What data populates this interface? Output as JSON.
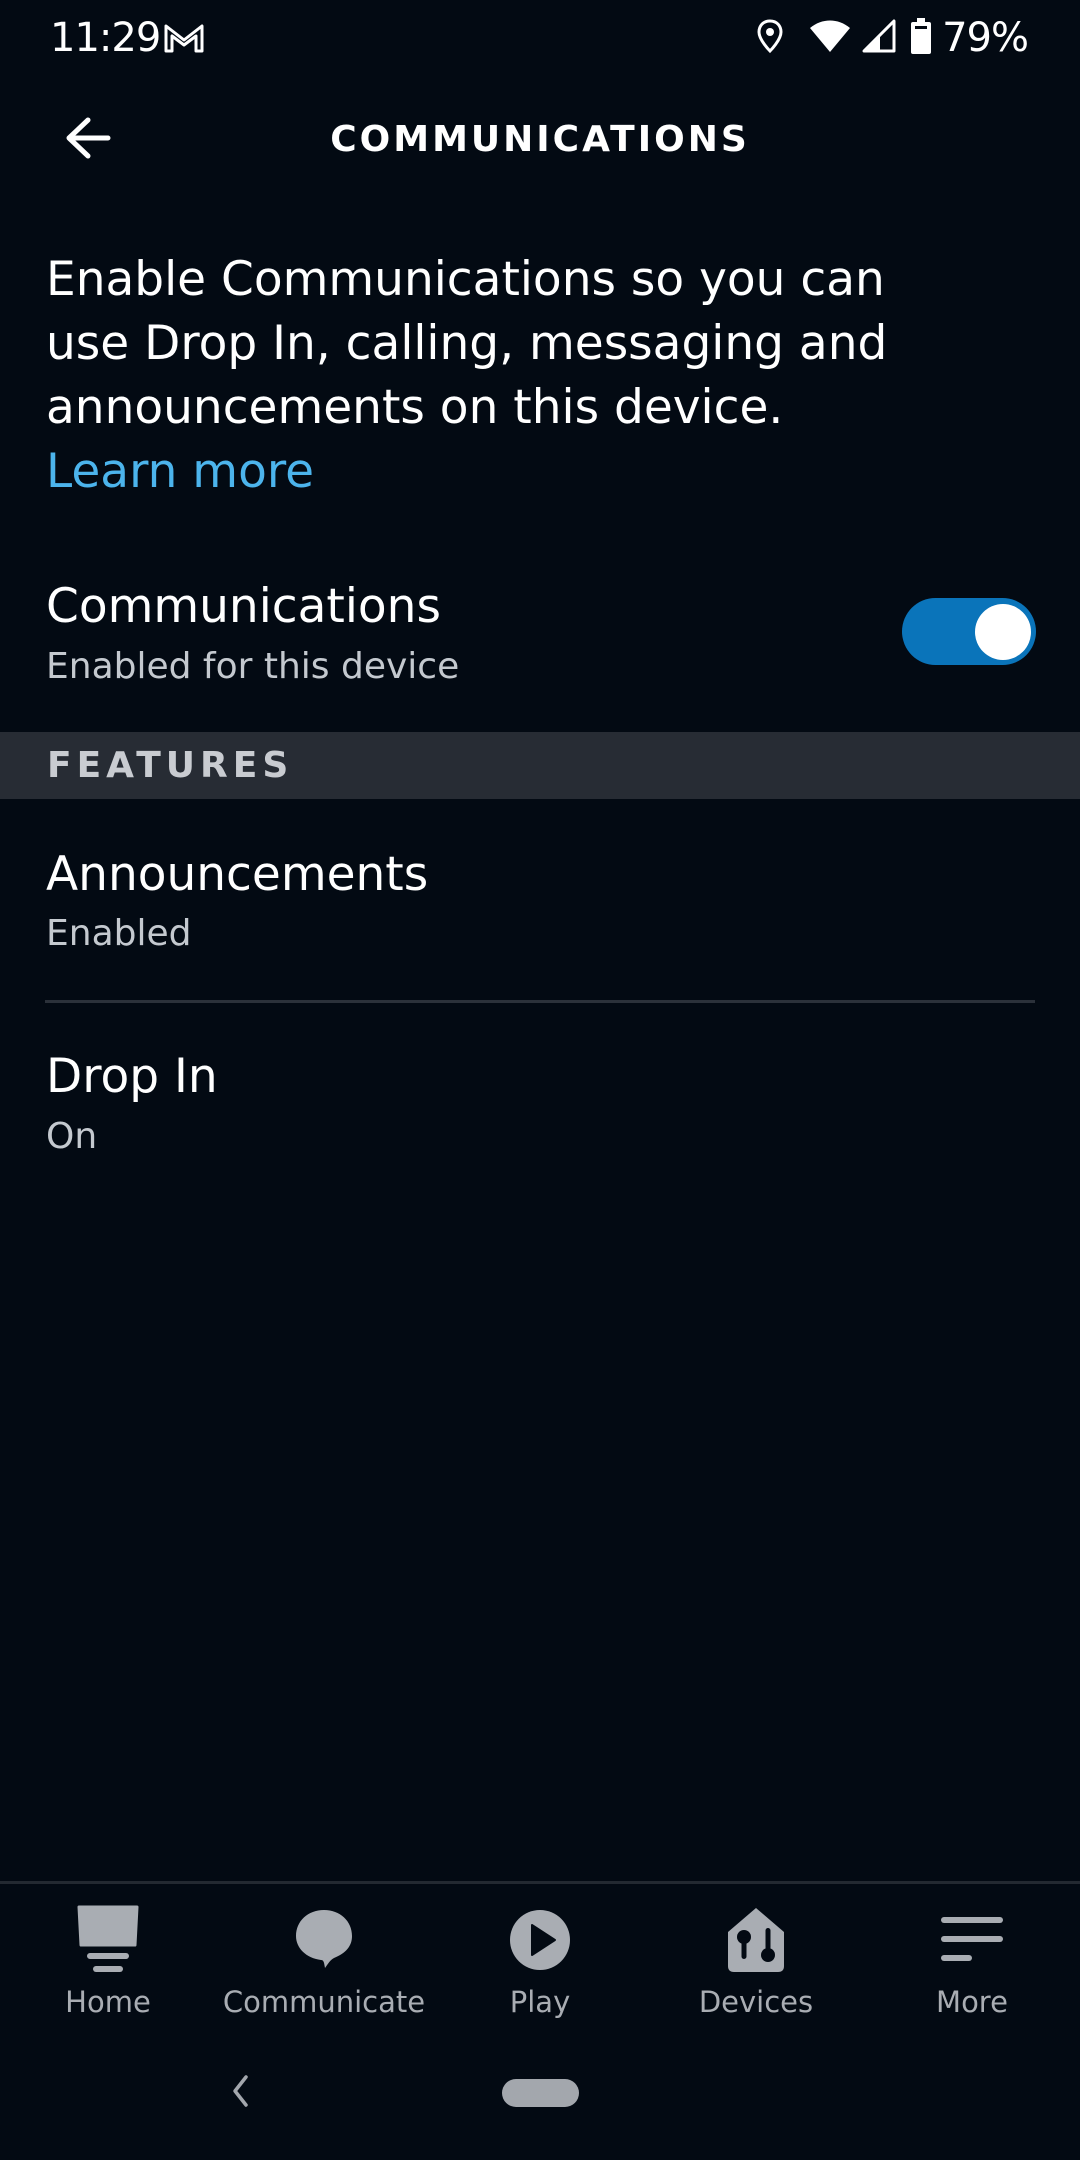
{
  "status_bar": {
    "time": "11:29",
    "notification_icons": [
      "gmail-icon"
    ],
    "system_icons": [
      "location-icon",
      "wifi-icon",
      "cellular-signal-icon",
      "battery-icon"
    ],
    "battery_percent": "79%"
  },
  "app_bar": {
    "back_icon": "arrow-left-icon",
    "title": "COMMUNICATIONS"
  },
  "intro": {
    "description": "Enable Communications so you can use Drop In, calling, messaging and announcements on this device.",
    "learn_more_label": "Learn more",
    "link_color": "#4cb4ec"
  },
  "communications_setting": {
    "title": "Communications",
    "subtitle": "Enabled for this device",
    "toggle_on": true,
    "toggle_color": "#0a74ba"
  },
  "features": {
    "header": "FEATURES",
    "items": [
      {
        "title": "Announcements",
        "subtitle": "Enabled"
      },
      {
        "title": "Drop In",
        "subtitle": "On"
      }
    ]
  },
  "bottom_nav": {
    "items": [
      {
        "label": "Home",
        "icon": "home-icon"
      },
      {
        "label": "Communicate",
        "icon": "chat-bubble-icon"
      },
      {
        "label": "Play",
        "icon": "play-icon"
      },
      {
        "label": "Devices",
        "icon": "devices-icon"
      },
      {
        "label": "More",
        "icon": "menu-icon"
      }
    ]
  },
  "system_nav": {
    "back_icon": "chevron-left-icon",
    "home_icon": "home-pill"
  },
  "colors": {
    "background": "#030a13",
    "section_band": "#272c34",
    "nav_icon": "#a9adb3"
  }
}
